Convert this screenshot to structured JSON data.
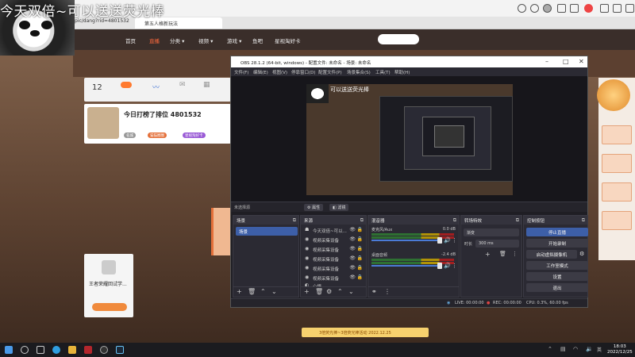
{
  "overlay": {
    "title": "今天双倍~可以送送荧光棒"
  },
  "browser": {
    "url": "pic/dang?rid=4801532",
    "tab_title": "第五人格新玩法",
    "nav": [
      "首页",
      "直播",
      "分类 ▾",
      "视频 ▾",
      "游戏 ▾",
      "鱼吧",
      "星视淘好卡"
    ]
  },
  "room": {
    "count": "12",
    "rank_title": "今日打榜了排位 4801532",
    "card_name": "王者荣耀回试学...",
    "badges": [
      "名城",
      "猫猫圈圈",
      "星视淘好卡"
    ]
  },
  "obs": {
    "title": "OBS 28.1.2 (64-bit, windows) - 配置文件: 未命名 - 场景: 未命名",
    "menu": [
      "文件(F)",
      "编辑(E)",
      "视图(V)",
      "停靠窗口(D)",
      "配置文件(P)",
      "场景集合(S)",
      "工具(T)",
      "帮助(H)"
    ],
    "canvas_title": "可以送送荧光棒",
    "no_source": "未选择源",
    "props_label": "属性",
    "filter_label": "滤镜",
    "docks": {
      "scenes": {
        "title": "场景",
        "items": [
          "场景"
        ]
      },
      "sources": {
        "title": "来源",
        "items": [
          {
            "glyph": "☗",
            "label": "今天双倍~可以..."
          },
          {
            "glyph": "◉",
            "label": "视频采集设备"
          },
          {
            "glyph": "◉",
            "label": "视频采集设备"
          },
          {
            "glyph": "◉",
            "label": "视频采集设备"
          },
          {
            "glyph": "◉",
            "label": "视频采集设备"
          },
          {
            "glyph": "◉",
            "label": "视频采集设备"
          },
          {
            "glyph": "◐",
            "label": "心情"
          }
        ]
      },
      "mixer": {
        "title": "混音器",
        "channels": [
          {
            "name": "麦克风/Aux",
            "db": "0.0 dB"
          },
          {
            "name": "桌面音频",
            "db": "-2.4 dB"
          }
        ]
      },
      "transitions": {
        "title": "转场特效",
        "type": "渐变",
        "duration_label": "时长",
        "duration": "300 ms"
      },
      "controls": {
        "title": "控制按钮",
        "buttons": [
          "停止直播",
          "开始录制",
          "启动虚拟摄像机",
          "工作室模式",
          "设置",
          "退出"
        ]
      }
    },
    "status": {
      "live": "LIVE: 00:00:00",
      "rec": "REC: 00:00:00",
      "cpu": "CPU: 0.3%, 60.00 fps"
    }
  },
  "bottom_strip": "3倍荧光棒~3倍荧光棒活动 2022.12.25",
  "taskbar": {
    "time": "18:03",
    "date": "2022/12/25"
  },
  "colors": {
    "accent": "#3d5fa8",
    "obs_bg": "#2b2a33",
    "site_orange": "#ff6a3d"
  }
}
